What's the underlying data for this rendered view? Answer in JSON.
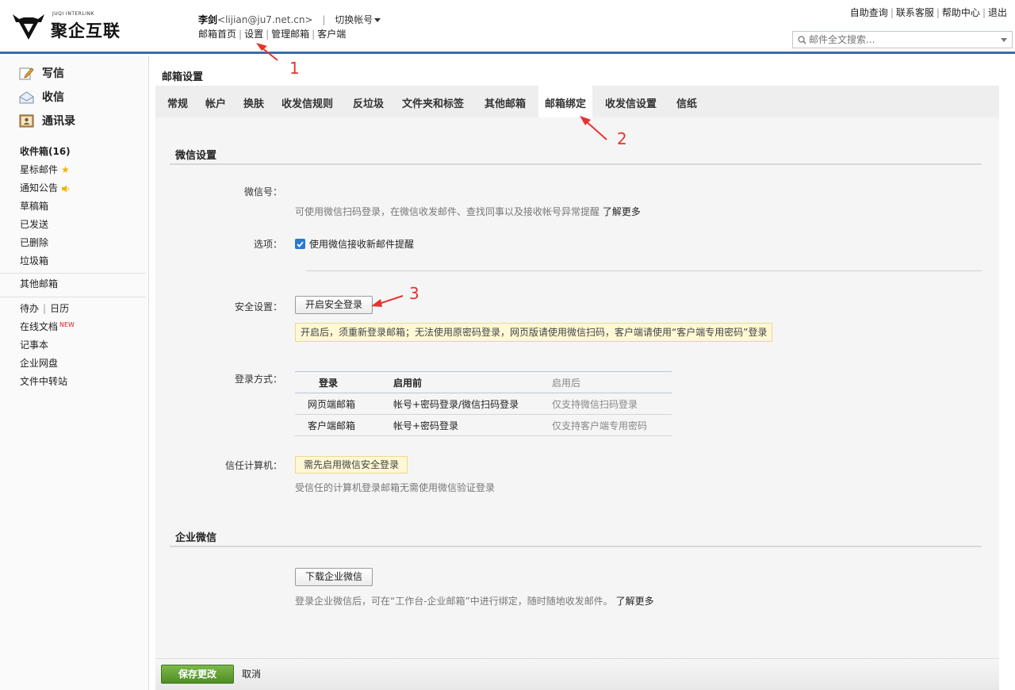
{
  "header": {
    "brand_name": "聚企互联",
    "brand_en": "JUQI INTERLINK",
    "user_name": "李剑",
    "user_email": "<lijian@ju7.net.cn>",
    "switch_account": "切换帐号",
    "nav": [
      "邮箱首页",
      "设置",
      "管理邮箱",
      "客户端"
    ],
    "top_links": [
      "自助查询",
      "联系客服",
      "帮助中心",
      "退出"
    ],
    "search_placeholder": "邮件全文搜索..."
  },
  "sidebar": {
    "actions": [
      "写信",
      "收信",
      "通讯录"
    ],
    "folders": [
      "收件箱(16)",
      "星标邮件",
      "通知公告",
      "草稿箱",
      "已发送",
      "已删除",
      "垃圾箱"
    ],
    "other_mailbox": "其他邮箱",
    "todo": "待办",
    "calendar": "日历",
    "online_docs": "在线文档",
    "new_badge": "NEW",
    "notes": "记事本",
    "net_disk": "企业网盘",
    "file_transfer": "文件中转站"
  },
  "main": {
    "page_title": "邮箱设置",
    "tabs": [
      "常规",
      "帐户",
      "换肤",
      "收发信规则",
      "反垃圾",
      "文件夹和标签",
      "其他邮箱",
      "邮箱绑定",
      "收发信设置",
      "信纸"
    ],
    "active_tab": "邮箱绑定"
  },
  "wechat": {
    "section_title": "微信设置",
    "wechat_id_label": "微信号：",
    "wechat_hint": "可使用微信扫码登录，在微信收发邮件、查找同事以及接收帐号异常提醒",
    "learn_more": "了解更多",
    "option_label": "选项：",
    "option_checkbox": "使用微信接收新邮件提醒",
    "security_label": "安全设置：",
    "enable_secure_login_btn": "开启安全登录",
    "secure_warning": "开启后，须重新登录邮箱；无法使用原密码登录，网页版请使用微信扫码，客户端请使用“客户端专用密码”登录",
    "login_method_label": "登录方式：",
    "table_headers": [
      "登录",
      "启用前",
      "启用后"
    ],
    "table_rows": [
      [
        "网页端邮箱",
        "帐号+密码登录/微信扫码登录",
        "仅支持微信扫码登录"
      ],
      [
        "客户端邮箱",
        "帐号+密码登录",
        "仅支持客户端专用密码"
      ]
    ],
    "trusted_label": "信任计算机：",
    "trusted_notice": "需先启用微信安全登录",
    "trusted_hint": "受信任的计算机登录邮箱无需使用微信验证登录"
  },
  "enterprise": {
    "section_title": "企业微信",
    "download_btn": "下载企业微信",
    "hint": "登录企业微信后，可在“工作台-企业邮箱”中进行绑定，随时随地收发邮件。",
    "learn_more": "了解更多"
  },
  "footer": {
    "save": "保存更改",
    "cancel": "取消"
  },
  "annotations": [
    "1",
    "2",
    "3"
  ],
  "colors": {
    "accent_blue": "#3a6ea5",
    "save_green": "#5a9a2e",
    "annotation_red": "#e8332f",
    "warning_bg": "#fff8d6"
  }
}
